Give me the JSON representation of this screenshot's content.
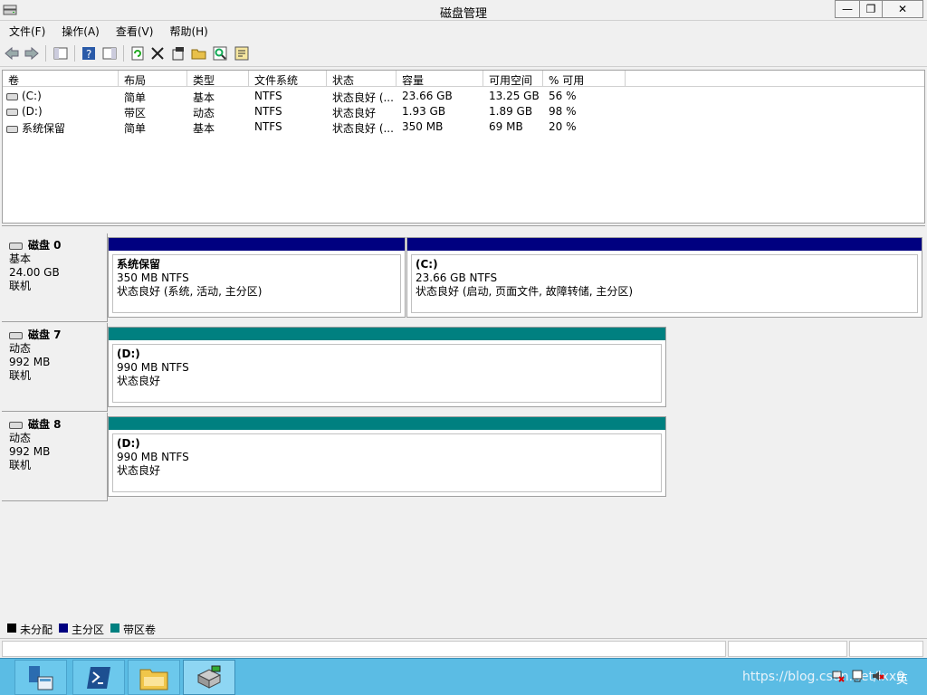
{
  "window": {
    "title": "磁盘管理",
    "minimize": "—",
    "restore": "❐",
    "close": "✕"
  },
  "menu": [
    "文件(F)",
    "操作(A)",
    "查看(V)",
    "帮助(H)"
  ],
  "toolbar": [
    "back-arrow-icon",
    "forward-arrow-icon",
    "console-tree-icon",
    "help-icon",
    "properties-pane-icon",
    "refresh-icon",
    "delete-icon",
    "properties-icon",
    "open-folder-icon",
    "search-icon",
    "export-icon"
  ],
  "volumes": {
    "headers": [
      "卷",
      "布局",
      "类型",
      "文件系统",
      "状态",
      "容量",
      "可用空间",
      "% 可用"
    ],
    "rows": [
      [
        "(C:)",
        "简单",
        "基本",
        "NTFS",
        "状态良好 (...",
        "23.66 GB",
        "13.25 GB",
        "56 %"
      ],
      [
        "(D:)",
        "带区",
        "动态",
        "NTFS",
        "状态良好",
        "1.93 GB",
        "1.89 GB",
        "98 %"
      ],
      [
        "系统保留",
        "简单",
        "基本",
        "NTFS",
        "状态良好 (...",
        "350 MB",
        "69 MB",
        "20 %"
      ]
    ]
  },
  "disks": [
    {
      "name": "磁盘 0",
      "type": "基本",
      "size": "24.00 GB",
      "state": "联机",
      "parts": [
        {
          "name": "系统保留",
          "size": "350 MB NTFS",
          "status": "状态良好 (系统, 活动, 主分区)"
        },
        {
          "name": "(C:)",
          "size": "23.66 GB NTFS",
          "status": "状态良好 (启动, 页面文件, 故障转储, 主分区)"
        }
      ]
    },
    {
      "name": "磁盘 7",
      "type": "动态",
      "size": "992 MB",
      "state": "联机",
      "parts": [
        {
          "name": "(D:)",
          "size": "990 MB NTFS",
          "status": "状态良好"
        }
      ]
    },
    {
      "name": "磁盘 8",
      "type": "动态",
      "size": "992 MB",
      "state": "联机",
      "parts": [
        {
          "name": "(D:)",
          "size": "990 MB NTFS",
          "status": "状态良好"
        }
      ]
    }
  ],
  "legend": [
    {
      "label": "未分配",
      "color": "#000000"
    },
    {
      "label": "主分区",
      "color": "#000080"
    },
    {
      "label": "带区卷",
      "color": "#008080"
    }
  ],
  "colors": {
    "primary": "#000080",
    "striped": "#008080"
  },
  "watermark": "https://blog.csdn.net/lxx0",
  "tray": {
    "lang": "英"
  }
}
